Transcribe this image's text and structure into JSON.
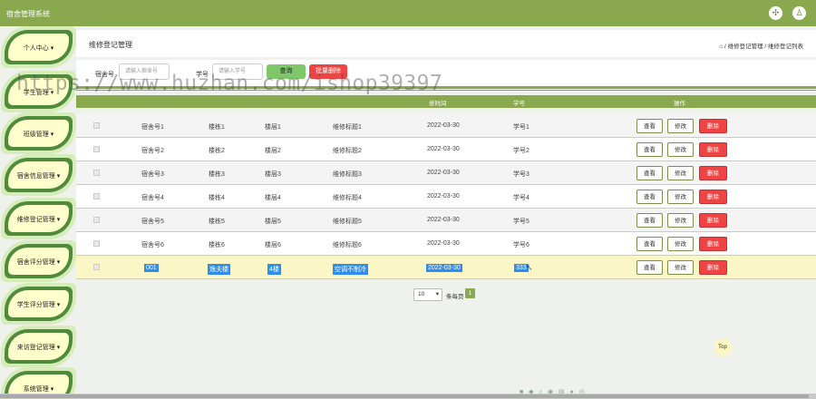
{
  "app": {
    "title": "宿舍管理系统"
  },
  "sidebar": {
    "items": [
      {
        "label": "个人中心"
      },
      {
        "label": "学生管理"
      },
      {
        "label": "班级管理"
      },
      {
        "label": "宿舍信息管理"
      },
      {
        "label": "维修登记管理"
      },
      {
        "label": "宿舍评分管理"
      },
      {
        "label": "学生评分管理"
      },
      {
        "label": "来访登记管理"
      },
      {
        "label": "系统管理"
      }
    ]
  },
  "header": {
    "title": "维修登记管理",
    "breadcrumb": "⌂ / 维修登记管理 / 维修登记列表"
  },
  "search": {
    "dorm_label": "宿舍号",
    "dorm_placeholder": "请输入宿舍号",
    "student_label": "学号",
    "student_placeholder": "请输入学号",
    "query_button": "查询",
    "batch_delete_button": "批量删除"
  },
  "table": {
    "headers": [
      "修时间",
      "学号",
      "操作"
    ],
    "rows": [
      {
        "c1": "宿舍号1",
        "c2": "楼栋1",
        "c3": "楼层1",
        "c4": "维修标题1",
        "c5": "2022-03-30",
        "c6": "学号1"
      },
      {
        "c1": "宿舍号2",
        "c2": "楼栋2",
        "c3": "楼层2",
        "c4": "维修标题2",
        "c5": "2022-03-30",
        "c6": "学号2"
      },
      {
        "c1": "宿舍号3",
        "c2": "楼栋3",
        "c3": "楼层3",
        "c4": "维修标题3",
        "c5": "2022-03-30",
        "c6": "学号3"
      },
      {
        "c1": "宿舍号4",
        "c2": "楼栋4",
        "c3": "楼层4",
        "c4": "维修标题4",
        "c5": "2022-03-30",
        "c6": "学号4"
      },
      {
        "c1": "宿舍号5",
        "c2": "楼栋5",
        "c3": "楼层5",
        "c4": "维修标题5",
        "c5": "2022-03-30",
        "c6": "学号5"
      },
      {
        "c1": "宿舍号6",
        "c2": "楼栋6",
        "c3": "楼层6",
        "c4": "维修标题6",
        "c5": "2022-03-30",
        "c6": "学号6"
      },
      {
        "c1": "001",
        "c2": "逸夫楼",
        "c3": "4楼",
        "c4": "空调不制冷",
        "c5": "2022-03-30",
        "c6": "333"
      }
    ],
    "actions": {
      "view": "查看",
      "edit": "修改",
      "delete": "删除"
    }
  },
  "pager": {
    "page_size": "10",
    "unit": "条每页",
    "current_page": "1"
  },
  "watermark": "https://www.huzhan.com/ishop39397",
  "top_button": "Top",
  "colors": {
    "primary": "#8aa94e",
    "accent_green": "#7ec86a",
    "danger": "#ef4444",
    "highlight_row": "#fbf6c5"
  }
}
